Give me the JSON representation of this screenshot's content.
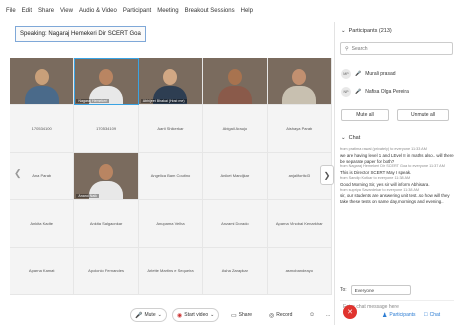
{
  "menu": [
    "File",
    "Edit",
    "Share",
    "View",
    "Audio & Video",
    "Participant",
    "Meeting",
    "Breakout Sessions",
    "Help"
  ],
  "speaking": "Speaking: Nagaraj Hemekeri Dir SCERT Goa",
  "grid": {
    "tiles": [
      {
        "name": "",
        "video": true
      },
      {
        "name": "Nagaraj Hemekeri",
        "video": true,
        "active": true
      },
      {
        "name": "Abhijeet Bhakai (Host me)",
        "video": true
      },
      {
        "name": "",
        "video": true
      },
      {
        "name": "",
        "video": true
      },
      {
        "name": "170534100",
        "video": false
      },
      {
        "name": "170534109",
        "video": false
      },
      {
        "name": "Aarti Shikerkar",
        "video": false
      },
      {
        "name": "Abigail Araujo",
        "video": false
      },
      {
        "name": "Aishaya Parab",
        "video": false
      },
      {
        "name": "Ana Parab",
        "video": false
      },
      {
        "name": "Anand Naik",
        "video": true
      },
      {
        "name": "Angelica Bam Coutino",
        "video": false
      },
      {
        "name": "Aniket Mandjkar",
        "video": false
      },
      {
        "name": "anjaliforttcl3",
        "video": false
      },
      {
        "name": "Ankita Kadte",
        "video": false
      },
      {
        "name": "Ankita Salgaonkar",
        "video": false
      },
      {
        "name": "Anupama Velha",
        "video": false
      },
      {
        "name": "Anzami Dorado",
        "video": false
      },
      {
        "name": "Aparna Vinobai Kenarkhar",
        "video": false
      },
      {
        "name": "Aparna Kamat",
        "video": false
      },
      {
        "name": "Apolonio Fernandes",
        "video": false
      },
      {
        "name": "Arlette Martins e Sequeira",
        "video": false
      },
      {
        "name": "Asha Zarapkar",
        "video": false
      },
      {
        "name": "asmobandeayo",
        "video": false
      }
    ]
  },
  "panel": {
    "participants_title": "Participants (213)",
    "search_placeholder": "Search",
    "participants": [
      {
        "initials": "MP",
        "name": "Murali prasad"
      },
      {
        "initials": "NP",
        "name": "Nafisa Olga Pereira"
      }
    ],
    "mute_all": "Mute all",
    "unmute_all": "Unmute all",
    "chat_title": "Chat",
    "chat_messages": [
      {
        "meta": "from pratima rawal (privately) to everyone   11:33 AM",
        "text": "we are having level 1 and LEvel II in maths also.. will there be separate paper for both?"
      },
      {
        "meta": "from Nagaraj Hemekeri Dir SCERT Goa to everyone   11:37 AM",
        "text": "This is Director SCERT May I speak."
      },
      {
        "meta": "from Sandip Kotkar to everyone   11:38 AM",
        "text": "Good Morning Sir, yes sir will inform Abhisara."
      },
      {
        "meta": "from supriya Savardekar to everyone   11:38 AM",
        "text": "sir, our students are answering unit test..so how will they take these tests on same day,mornings and evening.."
      }
    ],
    "to_label": "To:",
    "to_value": "Everyone",
    "chat_placeholder": "Enter chat message here"
  },
  "toolbar": {
    "mute": "Mute",
    "start_video": "Start video",
    "share": "Share",
    "record": "Record",
    "more": "...",
    "participants": "Participants",
    "chat": "Chat"
  },
  "colors": {
    "accent": "#3aa3e3",
    "end_call": "#e0332e"
  }
}
